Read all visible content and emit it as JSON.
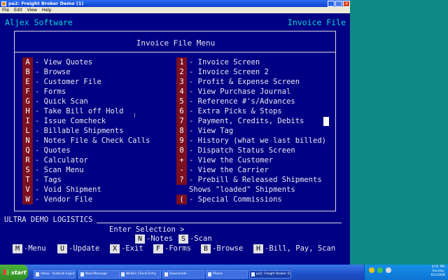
{
  "window": {
    "title": "pa2: Freight Broker Demo (1)",
    "menu": [
      "File",
      "Edit",
      "View",
      "Help"
    ],
    "controls": [
      "_",
      "□",
      "×"
    ]
  },
  "app_name": "Aljex Software",
  "screen_name": "Invoice File",
  "menu_title": "Invoice File Menu",
  "left_options": [
    {
      "key": "A",
      "label": "- View Quotes"
    },
    {
      "key": "B",
      "label": "- Browse"
    },
    {
      "key": "E",
      "label": "- Customer File"
    },
    {
      "key": "F",
      "label": "- Forms"
    },
    {
      "key": "G",
      "label": "- Quick Scan"
    },
    {
      "key": "H",
      "label": "- Take Bill off Hold"
    },
    {
      "key": "I",
      "label": "- Issue Comcheck"
    },
    {
      "key": "L",
      "label": "- Billable Shipments"
    },
    {
      "key": "N",
      "label": "- Notes File & Check Calls"
    },
    {
      "key": "Q",
      "label": "- Quotes"
    },
    {
      "key": "R",
      "label": "- Calculator"
    },
    {
      "key": "S",
      "label": "- Scan Menu"
    },
    {
      "key": "T",
      "label": "- Tags"
    },
    {
      "key": "V",
      "label": "- Void Shipment"
    },
    {
      "key": "W",
      "label": "- Vendor File"
    }
  ],
  "right_options": [
    {
      "key": "1",
      "label": "- Invoice Screen"
    },
    {
      "key": "2",
      "label": "- Invoice Screen 2"
    },
    {
      "key": "3",
      "label": "- Profit & Expense Screen"
    },
    {
      "key": "4",
      "label": "- View Purchase Journal"
    },
    {
      "key": "5",
      "label": "- Reference #'s/Advances"
    },
    {
      "key": "6",
      "label": "- Extra Picks & Stops"
    },
    {
      "key": "7",
      "label": "- Payment, Credits, Debits"
    },
    {
      "key": "8",
      "label": "- View Tag"
    },
    {
      "key": "9",
      "label": "- History (what we last billed)"
    },
    {
      "key": "0",
      "label": "- Dispatch Status Screen"
    },
    {
      "key": "+",
      "label": "- View the Customer"
    },
    {
      "key": "-",
      "label": "- View the Carrier"
    },
    {
      "key": "?",
      "label": "- Prebill & Released Shipments"
    },
    {
      "key": "",
      "label": "Shows \"loaded\" Shipments"
    },
    {
      "key": "(",
      "label": "- Special Commissions"
    }
  ],
  "company": "ULTRA DEMO LOGISTICS",
  "prompt": "Enter Selection >",
  "function_keys_row1": [
    {
      "key": "N",
      "label": "-Notes"
    },
    {
      "key": "S",
      "label": "-Scan"
    }
  ],
  "function_keys_row2": [
    {
      "key": "M",
      "label": "-Menu"
    },
    {
      "key": "U",
      "label": "-Update"
    },
    {
      "key": "X",
      "label": "-Exit"
    },
    {
      "key": "F",
      "label": "-Forms"
    },
    {
      "key": "B",
      "label": "-Browse"
    },
    {
      "key": "H",
      "label": "-Bill, Pay, Scan"
    }
  ],
  "taskbar": {
    "start": "start",
    "tasks": [
      {
        "label": "Inbox - Outlook Express",
        "active": false
      },
      {
        "label": "New Message",
        "active": false
      },
      {
        "label": "WebEx Client Entry",
        "active": false
      },
      {
        "label": "Downloads",
        "active": false
      },
      {
        "label": "Phone",
        "active": false
      },
      {
        "label": "pa2: Freight Broker D...",
        "active": true
      }
    ],
    "clock_time": "6:51 PM",
    "clock_day": "Sunday",
    "clock_date": "6/1/2008"
  }
}
